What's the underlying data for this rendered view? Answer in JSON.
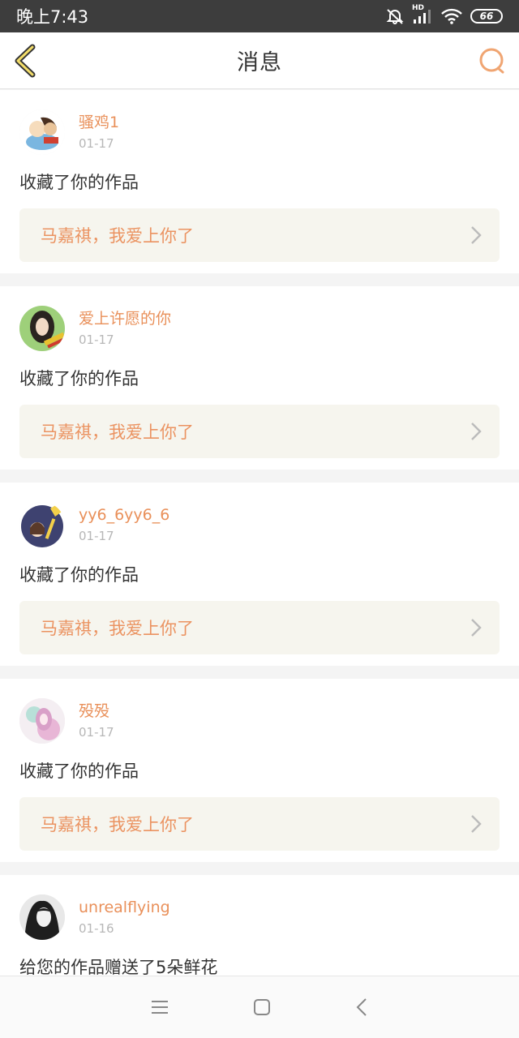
{
  "status_bar": {
    "time": "晚上7:43",
    "battery": "66",
    "network_label": "HD"
  },
  "header": {
    "title": "消息",
    "back_icon": "back-chevron-icon",
    "search_icon": "search-icon"
  },
  "colors": {
    "accent": "#e9905a",
    "link_bg": "#f6f5ee",
    "date": "#b7b7b7"
  },
  "messages": [
    {
      "username": "骚鸡1",
      "date": "01-17",
      "action": "收藏了你的作品",
      "work_title": "马嘉祺，我爱上你了"
    },
    {
      "username": "爱上许愿的你",
      "date": "01-17",
      "action": "收藏了你的作品",
      "work_title": "马嘉祺，我爱上你了"
    },
    {
      "username": "yy6_6yy6_6",
      "date": "01-17",
      "action": "收藏了你的作品",
      "work_title": "马嘉祺，我爱上你了"
    },
    {
      "username": "殁殁",
      "date": "01-17",
      "action": "收藏了你的作品",
      "work_title": "马嘉祺，我爱上你了"
    },
    {
      "username": "unrealflying",
      "date": "01-16",
      "action": "给您的作品赠送了5朵鲜花",
      "work_title": ""
    }
  ],
  "nav_bar": {
    "icons": [
      "menu-icon",
      "home-icon",
      "back-icon"
    ]
  }
}
